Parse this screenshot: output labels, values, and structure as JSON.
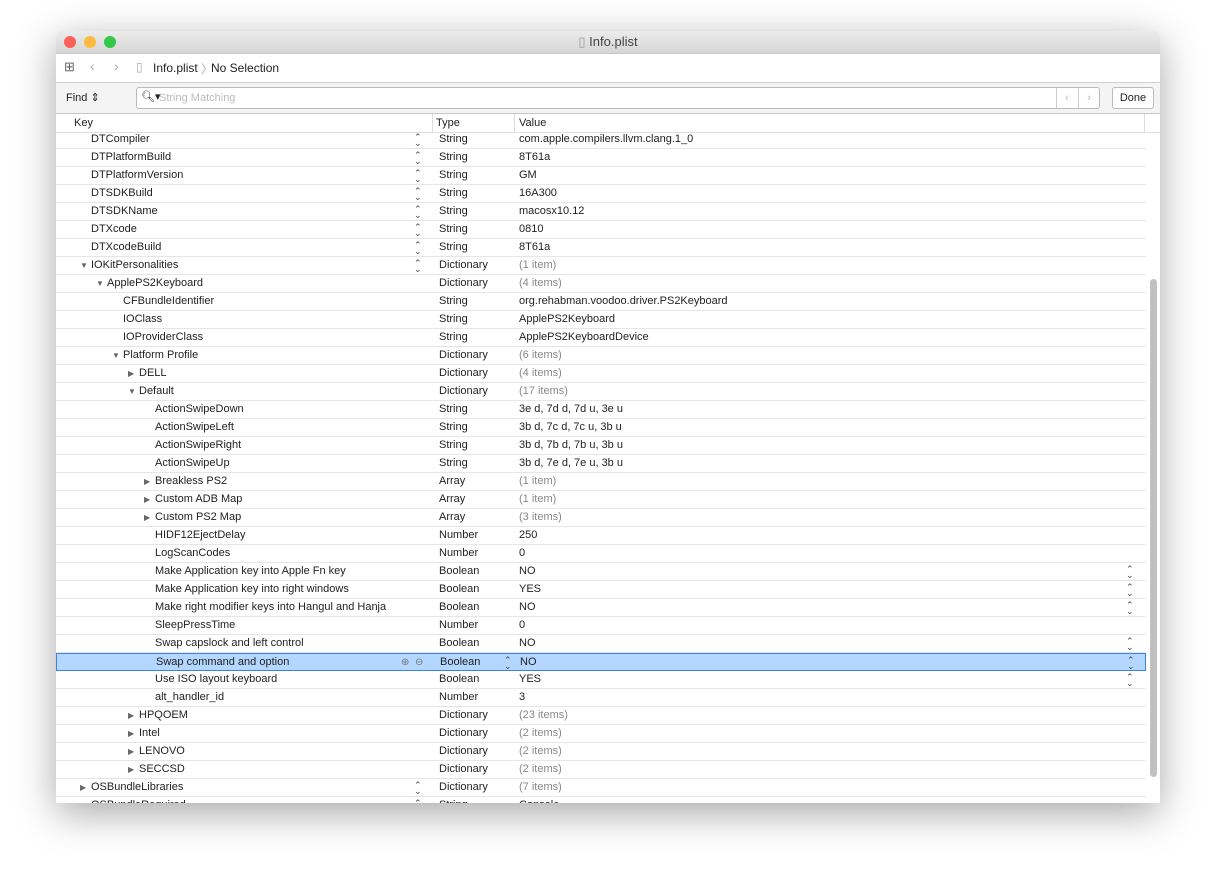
{
  "window": {
    "title": "Info.plist"
  },
  "pathbar": {
    "file": "Info.plist",
    "selection": "No Selection"
  },
  "find": {
    "mode": "Find",
    "placeholder": "String Matching",
    "done": "Done"
  },
  "header": {
    "key": "Key",
    "type": "Type",
    "value": "Value"
  },
  "rows": [
    {
      "level": 0,
      "key": "DTCompiler",
      "type": "String",
      "value": "com.apple.compilers.llvm.clang.1_0",
      "ks": 1
    },
    {
      "level": 0,
      "key": "DTPlatformBuild",
      "type": "String",
      "value": "8T61a",
      "ks": 1
    },
    {
      "level": 0,
      "key": "DTPlatformVersion",
      "type": "String",
      "value": "GM",
      "ks": 1
    },
    {
      "level": 0,
      "key": "DTSDKBuild",
      "type": "String",
      "value": "16A300",
      "ks": 1
    },
    {
      "level": 0,
      "key": "DTSDKName",
      "type": "String",
      "value": "macosx10.12",
      "ks": 1
    },
    {
      "level": 0,
      "key": "DTXcode",
      "type": "String",
      "value": "0810",
      "ks": 1
    },
    {
      "level": 0,
      "key": "DTXcodeBuild",
      "type": "String",
      "value": "8T61a",
      "ks": 1
    },
    {
      "level": 0,
      "key": "IOKitPersonalities",
      "type": "Dictionary",
      "value": "(1 item)",
      "tri": "open",
      "dim": 1,
      "ks": 1
    },
    {
      "level": 1,
      "key": "ApplePS2Keyboard",
      "type": "Dictionary",
      "value": "(4 items)",
      "tri": "open",
      "dim": 1
    },
    {
      "level": 2,
      "key": "CFBundleIdentifier",
      "type": "String",
      "value": "org.rehabman.voodoo.driver.PS2Keyboard"
    },
    {
      "level": 2,
      "key": "IOClass",
      "type": "String",
      "value": "ApplePS2Keyboard"
    },
    {
      "level": 2,
      "key": "IOProviderClass",
      "type": "String",
      "value": "ApplePS2KeyboardDevice"
    },
    {
      "level": 2,
      "key": "Platform Profile",
      "type": "Dictionary",
      "value": "(6 items)",
      "tri": "open",
      "dim": 1
    },
    {
      "level": 3,
      "key": "DELL",
      "type": "Dictionary",
      "value": "(4 items)",
      "tri": "closed",
      "dim": 1
    },
    {
      "level": 3,
      "key": "Default",
      "type": "Dictionary",
      "value": "(17 items)",
      "tri": "open",
      "dim": 1
    },
    {
      "level": 4,
      "key": "ActionSwipeDown",
      "type": "String",
      "value": "3e d, 7d d, 7d u, 3e u"
    },
    {
      "level": 4,
      "key": "ActionSwipeLeft",
      "type": "String",
      "value": "3b d, 7c d, 7c u, 3b u"
    },
    {
      "level": 4,
      "key": "ActionSwipeRight",
      "type": "String",
      "value": "3b d, 7b d, 7b u, 3b u"
    },
    {
      "level": 4,
      "key": "ActionSwipeUp",
      "type": "String",
      "value": "3b d, 7e d, 7e u, 3b u"
    },
    {
      "level": 4,
      "key": "Breakless PS2",
      "type": "Array",
      "value": "(1 item)",
      "tri": "closed",
      "dim": 1
    },
    {
      "level": 4,
      "key": "Custom ADB Map",
      "type": "Array",
      "value": "(1 item)",
      "tri": "closed",
      "dim": 1
    },
    {
      "level": 4,
      "key": "Custom PS2 Map",
      "type": "Array",
      "value": "(3 items)",
      "tri": "closed",
      "dim": 1
    },
    {
      "level": 4,
      "key": "HIDF12EjectDelay",
      "type": "Number",
      "value": "250"
    },
    {
      "level": 4,
      "key": "LogScanCodes",
      "type": "Number",
      "value": "0"
    },
    {
      "level": 4,
      "key": "Make Application key into Apple Fn key",
      "type": "Boolean",
      "value": "NO",
      "vs": 1
    },
    {
      "level": 4,
      "key": "Make Application key into right windows",
      "type": "Boolean",
      "value": "YES",
      "vs": 1
    },
    {
      "level": 4,
      "key": "Make right modifier keys into Hangul and Hanja",
      "type": "Boolean",
      "value": "NO",
      "vs": 1
    },
    {
      "level": 4,
      "key": "SleepPressTime",
      "type": "Number",
      "value": "0"
    },
    {
      "level": 4,
      "key": "Swap capslock and left control",
      "type": "Boolean",
      "value": "NO",
      "vs": 1
    },
    {
      "level": 4,
      "key": "Swap command and option",
      "type": "Boolean",
      "value": "NO",
      "vs": 1,
      "sel": 1
    },
    {
      "level": 4,
      "key": "Use ISO layout keyboard",
      "type": "Boolean",
      "value": "YES",
      "vs": 1
    },
    {
      "level": 4,
      "key": "alt_handler_id",
      "type": "Number",
      "value": "3"
    },
    {
      "level": 3,
      "key": "HPQOEM",
      "type": "Dictionary",
      "value": "(23 items)",
      "tri": "closed",
      "dim": 1
    },
    {
      "level": 3,
      "key": "Intel",
      "type": "Dictionary",
      "value": "(2 items)",
      "tri": "closed",
      "dim": 1
    },
    {
      "level": 3,
      "key": "LENOVO",
      "type": "Dictionary",
      "value": "(2 items)",
      "tri": "closed",
      "dim": 1
    },
    {
      "level": 3,
      "key": "SECCSD",
      "type": "Dictionary",
      "value": "(2 items)",
      "tri": "closed",
      "dim": 1
    },
    {
      "level": 0,
      "key": "OSBundleLibraries",
      "type": "Dictionary",
      "value": "(7 items)",
      "tri": "closed",
      "dim": 1,
      "ks": 1
    },
    {
      "level": 0,
      "key": "OSBundleRequired",
      "type": "String",
      "value": "Console",
      "ks": 1
    }
  ]
}
